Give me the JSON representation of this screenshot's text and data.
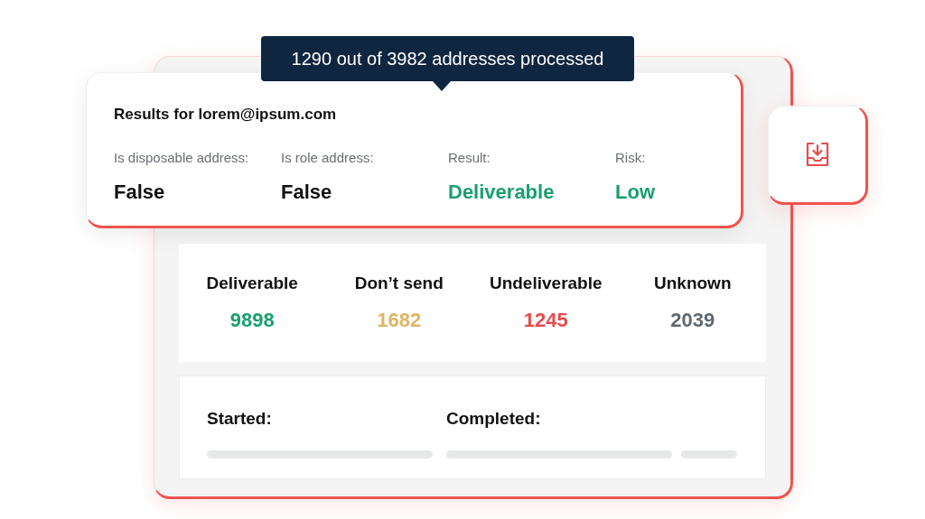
{
  "tooltip": {
    "text": "1290 out of 3982 addresses processed"
  },
  "result_card": {
    "title": "Results for lorem@ipsum.com",
    "fields": [
      {
        "label": "Is disposable address:",
        "value": "False",
        "color": "#111111"
      },
      {
        "label": "Is role address:",
        "value": "False",
        "color": "#111111"
      },
      {
        "label": "Result:",
        "value": "Deliverable",
        "color": "#1aa06d"
      },
      {
        "label": "Risk:",
        "value": "Low",
        "color": "#1aa06d"
      }
    ]
  },
  "stats": [
    {
      "label": "Deliverable",
      "value": "9898",
      "color": "#1aa06d"
    },
    {
      "label": "Don’t send",
      "value": "1682",
      "color": "#e0b462"
    },
    {
      "label": "Undeliverable",
      "value": "1245",
      "color": "#e84b4b"
    },
    {
      "label": "Unknown",
      "value": "2039",
      "color": "#5f6771"
    }
  ],
  "timing": {
    "started": {
      "label": "Started:"
    },
    "completed": {
      "label": "Completed:"
    }
  }
}
